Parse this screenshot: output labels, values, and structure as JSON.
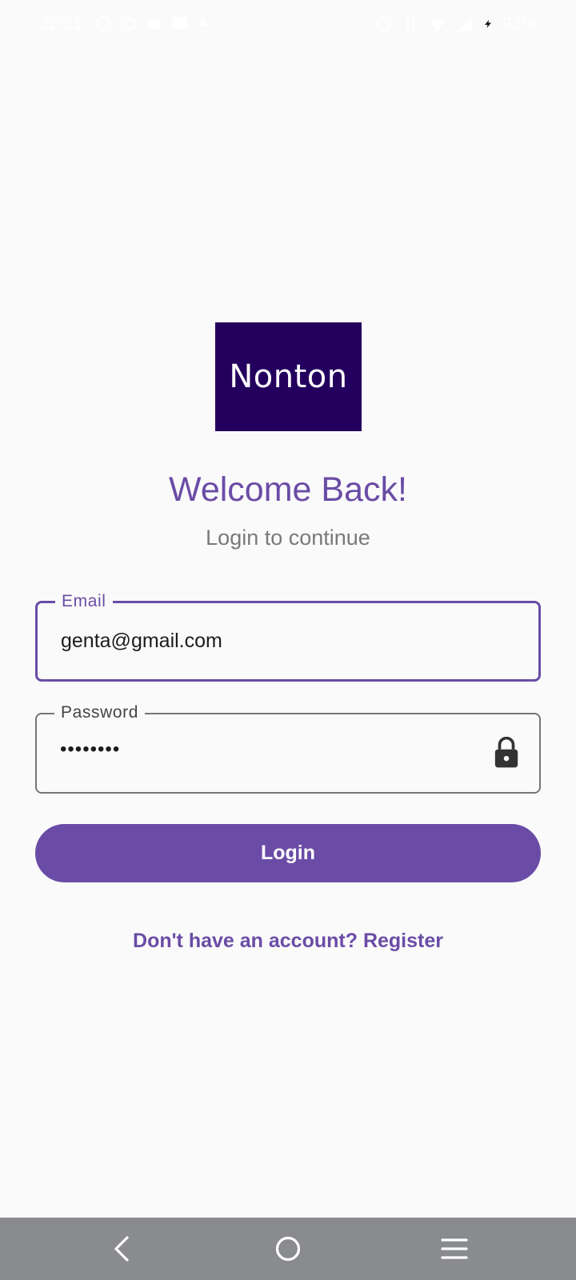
{
  "status_bar": {
    "time": "22:21",
    "battery": "93%"
  },
  "logo": {
    "text": "Nonton"
  },
  "header": {
    "title": "Welcome Back!",
    "subtitle": "Login to continue"
  },
  "form": {
    "email": {
      "label": "Email",
      "value": "genta@gmail.com"
    },
    "password": {
      "label": "Password",
      "value": "••••••••"
    },
    "login_label": "Login",
    "register_link": "Don't have an account? Register"
  },
  "colors": {
    "primary": "#6a4ca6",
    "logo_background": "#24005e",
    "background": "#fafafa",
    "nav_bar": "#8a8b8f"
  },
  "icons": {
    "password_trailing": "lock-icon",
    "nav": [
      "back-icon",
      "home-icon",
      "menu-icon"
    ]
  }
}
